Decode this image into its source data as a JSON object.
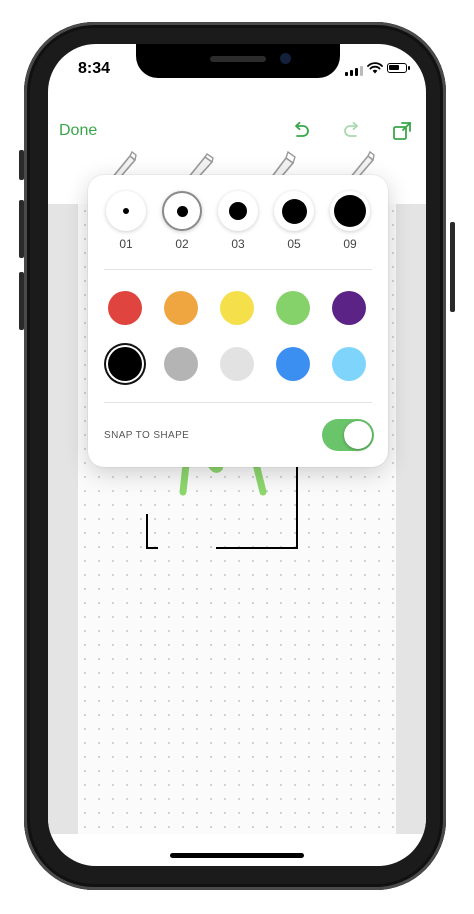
{
  "status_bar": {
    "time": "8:34"
  },
  "toolbar": {
    "done_label": "Done",
    "icons": [
      "undo-icon",
      "redo-icon",
      "share-icon"
    ]
  },
  "pen_tools": [
    "pen-tool-1",
    "pen-tool-2",
    "pen-tool-3",
    "pen-tool-4"
  ],
  "sizes": [
    {
      "label": "01",
      "selected": false
    },
    {
      "label": "02",
      "selected": true
    },
    {
      "label": "03",
      "selected": false
    },
    {
      "label": "05",
      "selected": false
    },
    {
      "label": "09",
      "selected": false
    }
  ],
  "colors": {
    "row1": [
      "#e0443f",
      "#efa640",
      "#f5df4b",
      "#86d26a",
      "#5b2385"
    ],
    "row2": [
      "#000000",
      "#b4b4b4",
      "#e2e2e2",
      "#3b8ff0",
      "#7fd4fb"
    ],
    "selected": "#000000"
  },
  "snap": {
    "label": "SNAP TO SHAPE",
    "enabled": true
  },
  "accent": "#3aa64b"
}
